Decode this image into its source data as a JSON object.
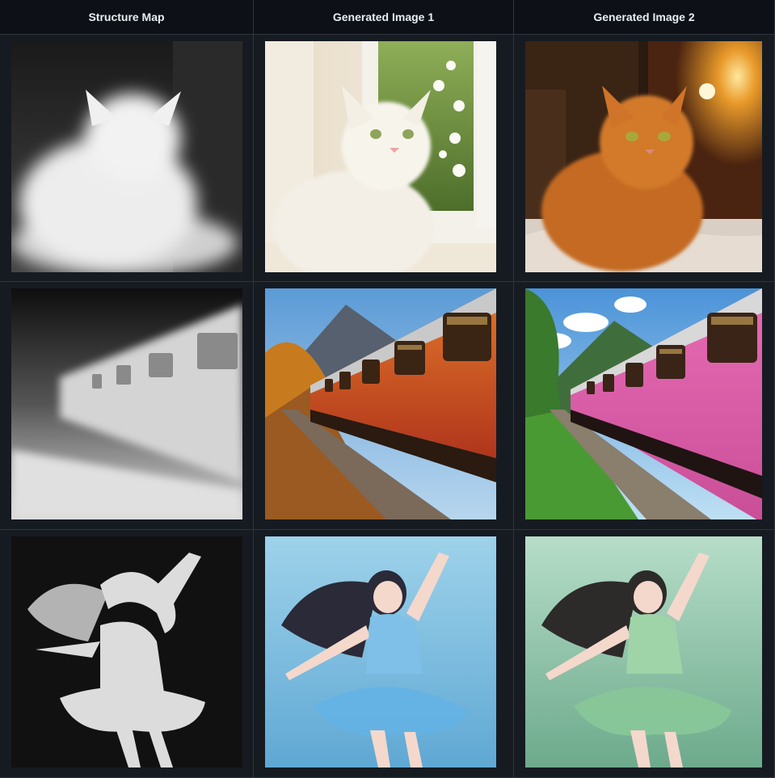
{
  "table": {
    "headers": [
      "Structure Map",
      "Generated Image 1",
      "Generated Image 2"
    ],
    "rows": [
      {
        "subject": "cat",
        "images": [
          "depth-map",
          "white-cat-window",
          "orange-cat-bed"
        ]
      },
      {
        "subject": "train",
        "images": [
          "depth-map",
          "orange-train-autumn",
          "pink-train-summer"
        ]
      },
      {
        "subject": "dancer",
        "images": [
          "depth-map",
          "anime-girl-blue-dress",
          "anime-girl-green-dress"
        ]
      }
    ]
  }
}
